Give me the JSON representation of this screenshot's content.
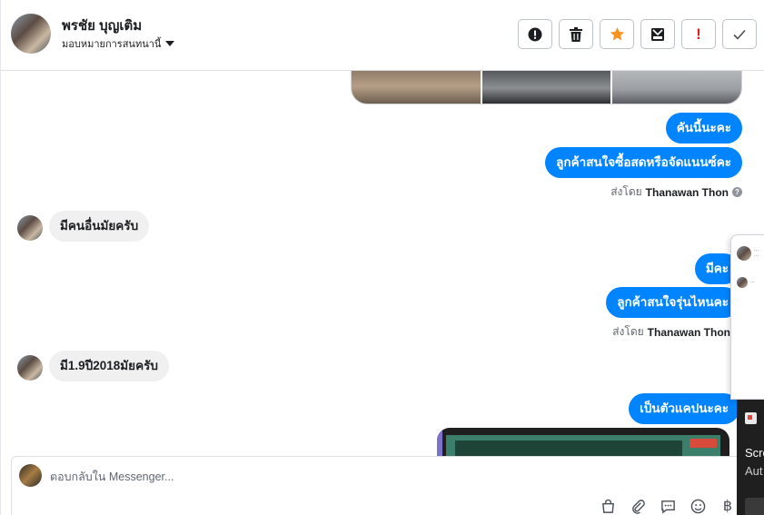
{
  "header": {
    "contact_name": "พรชัย บุญเติม",
    "assign_label": "มอบหมายการสนทนานี้",
    "actions": [
      {
        "name": "mark-spam",
        "icon": "alert-circle-icon"
      },
      {
        "name": "delete",
        "icon": "trash-icon"
      },
      {
        "name": "star",
        "icon": "star-icon"
      },
      {
        "name": "archive",
        "icon": "archive-icon"
      },
      {
        "name": "important",
        "icon": "exclamation-icon",
        "glyph": "!"
      },
      {
        "name": "done",
        "icon": "check-icon"
      }
    ]
  },
  "messages": [
    {
      "direction": "out",
      "text": "คันนี้นะคะ"
    },
    {
      "direction": "out",
      "text": "ลูกค้าสนใจซื้อสดหรือจัดแนนซ์คะ"
    },
    {
      "direction": "meta",
      "prefix": "ส่งโดย",
      "sender": "Thanawan Thon"
    },
    {
      "direction": "in",
      "text": "มีคนอื่นมัยครับ"
    },
    {
      "direction": "out",
      "text": "มีคะ"
    },
    {
      "direction": "out",
      "text": "ลูกค้าสนใจรุ่นไหนคะ"
    },
    {
      "direction": "meta",
      "prefix": "ส่งโดย",
      "sender": "Thanawan Thon"
    },
    {
      "direction": "in",
      "text": "มี1.9ปี2018มัยครับ"
    },
    {
      "direction": "out",
      "text": "เป็นตัวแคปนะคะ"
    }
  ],
  "composer": {
    "placeholder": "ตอบกลับใน Messenger...",
    "value": "",
    "tools": [
      "shopping-bag-icon",
      "paperclip-icon",
      "saved-replies-icon",
      "emoji-icon",
      "baht-icon"
    ]
  },
  "overlay": {
    "dark_panel": {
      "line1": "Scre",
      "line2": "Aut"
    }
  },
  "colors": {
    "outgoing_bubble": "#0084ff",
    "incoming_bubble": "#f1f0f0",
    "star": "#f7931e",
    "important": "#e02020"
  }
}
